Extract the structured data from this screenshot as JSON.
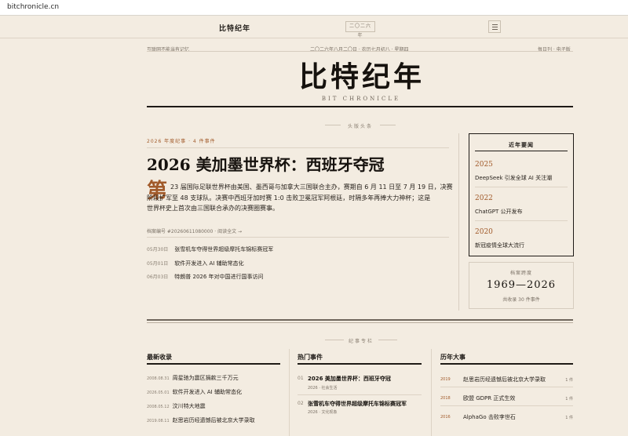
{
  "browser": {
    "url": "bitchronicle.cn"
  },
  "topnav": {
    "brand": "比特纪年",
    "year_badge": "二〇二六 年"
  },
  "masthead": {
    "left_meta": "互联网不能当有记忆",
    "date_line": "二〇二六年八月二〇日 · 农历七月初八 · 星期四",
    "right_meta": "每日刊 · 电子版",
    "title": "比特纪年",
    "subtitle": "BIT CHRONICLE",
    "section_label": "头版头条"
  },
  "lead": {
    "meta": "2026 年度纪事 · 4 件事件",
    "headline": "2026 美加墨世界杯：西班牙夺冠",
    "dropcap": "第",
    "body_line1": "23 届国际足联世界杯由美国、墨西哥与加拿大三国联合主办，赛期自 6 月 11 日至 7 月 19 日，决赛",
    "body_line2": "阶段扩军至 48 支球队。决赛中西班牙加时赛 1:0 击败卫冕冠军阿根廷，时隔多年再捧大力神杯；这是",
    "body_line3": "世界杯史上首次由三国联合承办的决赛圈赛事。",
    "archive_label": "档案编号 #20260611080000 · ",
    "read_more": "阅读全文 →",
    "related": [
      {
        "date": "05月30日",
        "title": "张雪机车夺得世界超级摩托车锦标赛冠军"
      },
      {
        "date": "05月01日",
        "title": "软件开发进入 AI 辅助常态化"
      },
      {
        "date": "06月03日",
        "title": "特朗普 2026 年对中国进行国事访问"
      }
    ]
  },
  "sidebar": {
    "title": "近年要闻",
    "items": [
      {
        "year": "2025",
        "text": "DeepSeek 引发全球 AI 关注潮"
      },
      {
        "year": "2022",
        "text": "ChatGPT 公开发布"
      },
      {
        "year": "2020",
        "text": "新冠疫情全球大流行"
      }
    ],
    "range_label": "档案跨度",
    "range_value": "1969—2026",
    "range_count": "共收录 30 件事件"
  },
  "columns_label": "纪事专栏",
  "col_latest": {
    "title": "最新收录",
    "items": [
      {
        "date": "2008.08.31",
        "title": "周星驰为震区捐款三千万元"
      },
      {
        "date": "2026.05.01",
        "title": "软件开发进入 AI 辅助常态化"
      },
      {
        "date": "2008.05.12",
        "title": "汶川特大地震"
      },
      {
        "date": "2019.08.11",
        "title": "赵思岩历经遗憾后被北京大学录取"
      }
    ]
  },
  "col_hot": {
    "title": "热门事件",
    "items": [
      {
        "num": "01",
        "title": "2026 美加墨世界杯：西班牙夺冠",
        "sub": "2026 · 社会生活"
      },
      {
        "num": "02",
        "title": "张雪机车夺得世界超级摩托车锦标赛冠军",
        "sub": "2026 · 文化现象"
      }
    ]
  },
  "col_history": {
    "title": "历年大事",
    "items": [
      {
        "year": "2019",
        "title": "赵思岩历经遗憾后被北京大学录取",
        "count": "1 件"
      },
      {
        "year": "2018",
        "title": "欧盟 GDPR 正式生效",
        "count": "1 件"
      },
      {
        "year": "2016",
        "title": "AlphaGo 击败李世石",
        "count": "1 件"
      }
    ]
  },
  "colors": {
    "accent": "#a15a2a",
    "ink": "#16120e",
    "paper": "#f3ece1"
  }
}
